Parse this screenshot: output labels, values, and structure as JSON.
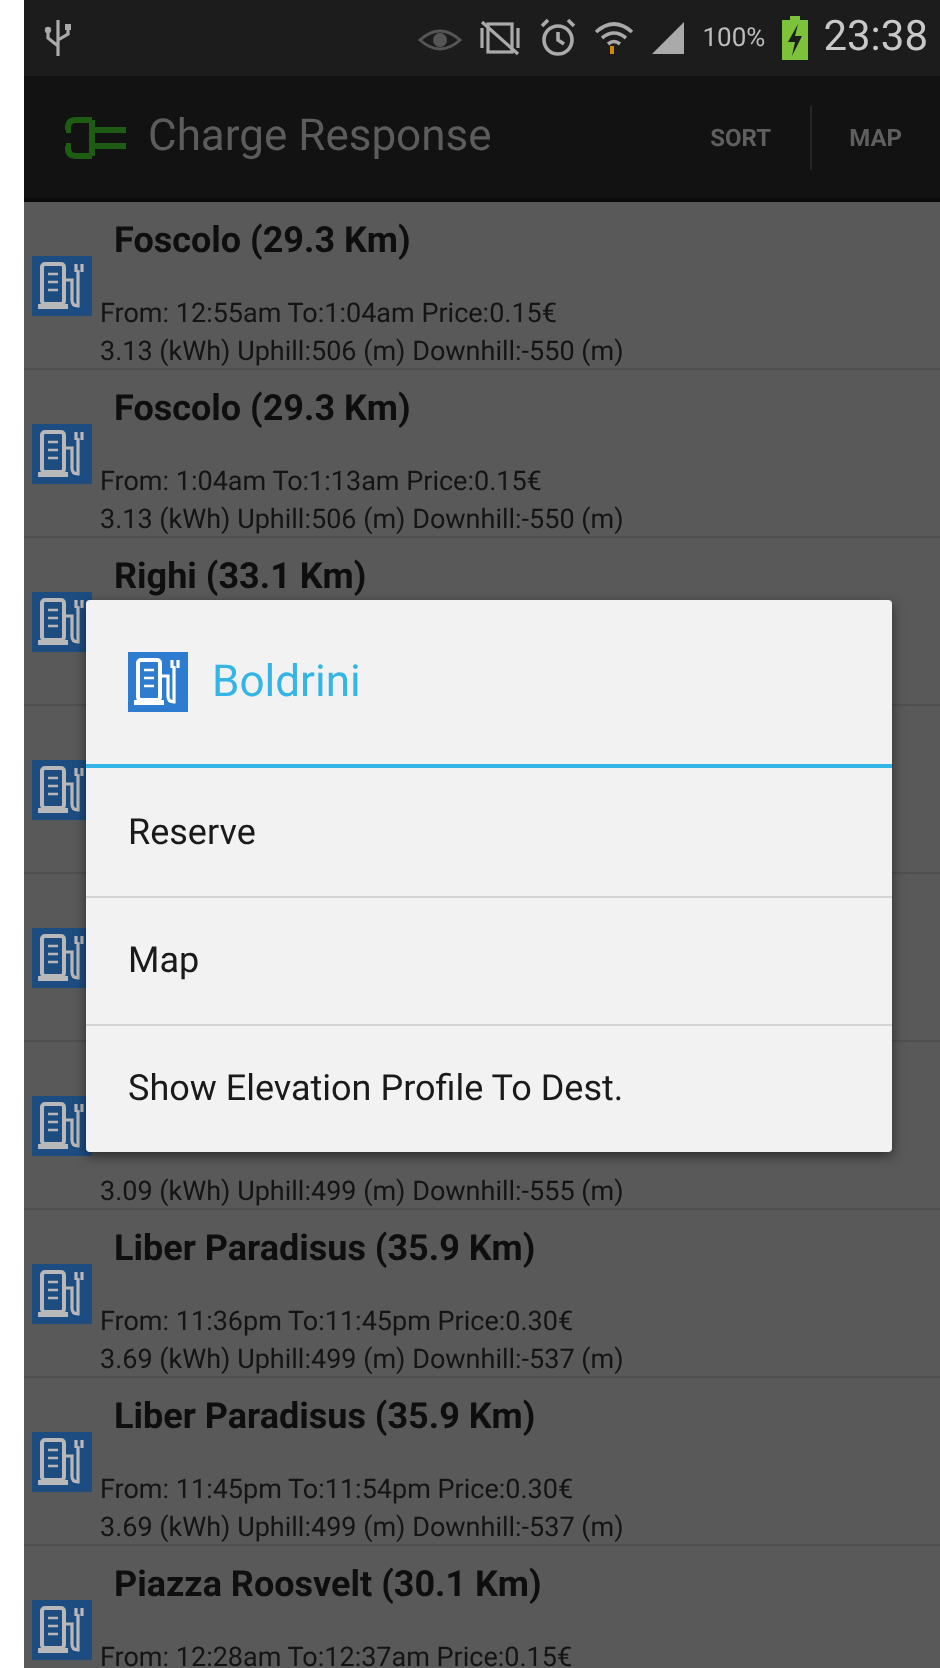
{
  "status_bar": {
    "battery_percent": "100%",
    "time": "23:38"
  },
  "action_bar": {
    "title": "Charge Response",
    "actions": [
      "SORT",
      "MAP"
    ]
  },
  "stations": [
    {
      "kind": "station",
      "title": "Foscolo (29.3 Km)",
      "line1": "From: 12:55am To:1:04am Price:0.15€",
      "line2": "3.13 (kWh) Uphill:506 (m) Downhill:-550 (m)"
    },
    {
      "kind": "station",
      "title": "Foscolo (29.3 Km)",
      "line1": "From: 1:04am To:1:13am Price:0.15€",
      "line2": "3.13 (kWh) Uphill:506 (m) Downhill:-550 (m)"
    },
    {
      "kind": "station",
      "title": "Righi (33.1 Km)"
    },
    {
      "kind": "station"
    },
    {
      "kind": "station"
    },
    {
      "kind": "station",
      "line2": "3.09 (kWh) Uphill:499 (m) Downhill:-555 (m)"
    },
    {
      "kind": "station",
      "title": "Liber Paradisus (35.9 Km)",
      "line1": "From: 11:36pm To:11:45pm Price:0.30€",
      "line2": "3.69 (kWh) Uphill:499 (m) Downhill:-537 (m)"
    },
    {
      "kind": "station",
      "title": "Liber Paradisus (35.9 Km)",
      "line1": "From: 11:45pm To:11:54pm Price:0.30€",
      "line2": "3.69 (kWh) Uphill:499 (m) Downhill:-537 (m)"
    },
    {
      "kind": "station",
      "title": "Piazza Roosvelt (30.1 Km)",
      "line1": "From: 12:28am To:12:37am Price:0.15€"
    }
  ],
  "dialog": {
    "title": "Boldrini",
    "items": [
      "Reserve",
      "Map",
      "Show Elevation Profile To Dest."
    ]
  }
}
